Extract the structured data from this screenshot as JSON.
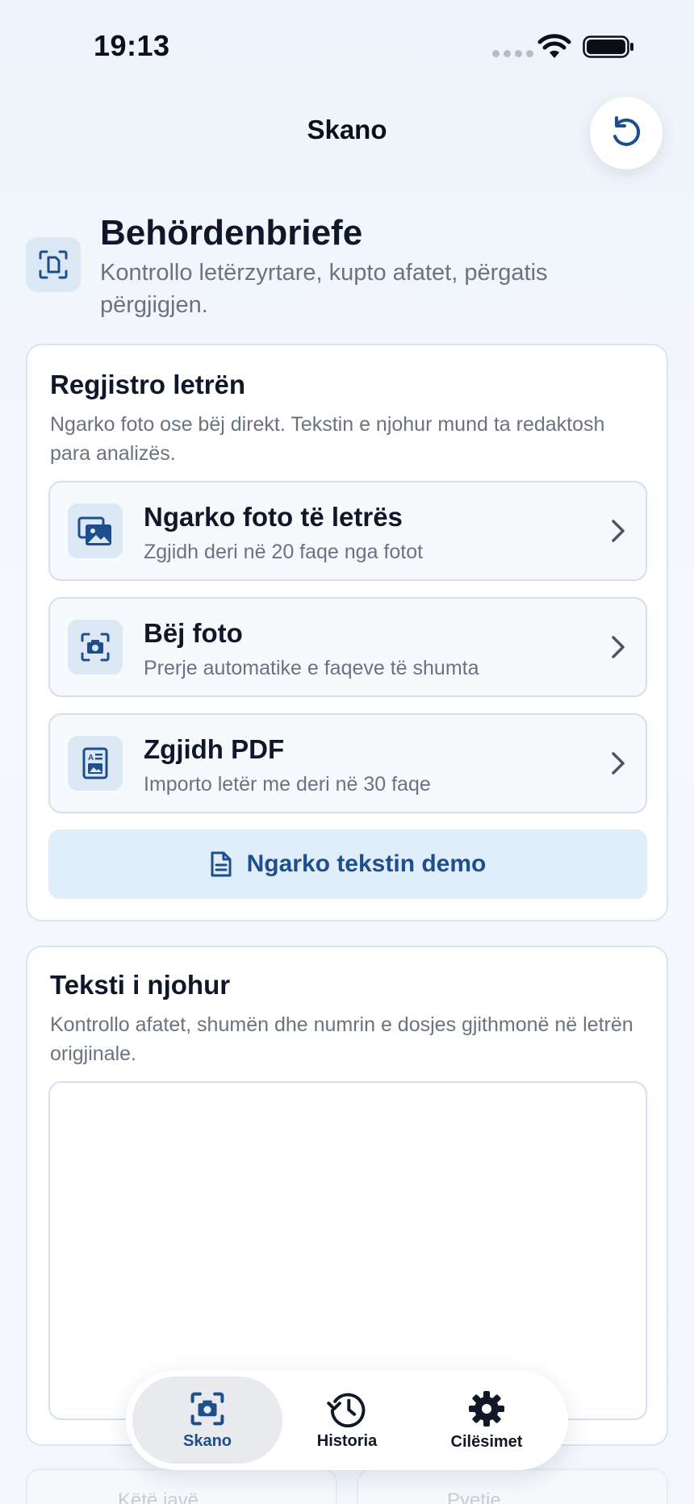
{
  "status_bar": {
    "time": "19:13"
  },
  "nav": {
    "title": "Skano",
    "reset_icon": "rotate-ccw-icon"
  },
  "header": {
    "title": "Behördenbriefe",
    "subtitle": "Kontrollo letërzyrtare, kupto afatet, përgatis përgjigjen.",
    "icon": "document-scan-icon"
  },
  "upload_card": {
    "title": "Regjistro letrën",
    "description": "Ngarko foto ose bëj direkt. Tekstin e njohur mund ta redaktosh para analizës.",
    "options": [
      {
        "title": "Ngarko foto të letrës",
        "subtitle": "Zgjidh deri në 20 faqe nga fotot",
        "icon": "photo-stack-icon"
      },
      {
        "title": "Bëj foto",
        "subtitle": "Prerje automatike e faqeve të shumta",
        "icon": "camera-scan-icon"
      },
      {
        "title": "Zgjidh PDF",
        "subtitle": "Importo letër me deri në 30 faqe",
        "icon": "pdf-document-icon"
      }
    ],
    "demo_button": "Ngarko tekstin demo"
  },
  "text_card": {
    "title": "Teksti i njohur",
    "description": "Kontrollo afatet, shumën dhe numrin e dosjes gjithmonë në letrën origjinale.",
    "text_value": ""
  },
  "faded_cards": [
    "Këtë javë",
    "Pyetje"
  ],
  "tab_bar": {
    "active": "Skano",
    "tabs": [
      {
        "label": "Skano",
        "icon": "camera-scan-icon"
      },
      {
        "label": "Historia",
        "icon": "history-clock-icon"
      },
      {
        "label": "Cilësimet",
        "icon": "gear-icon"
      }
    ]
  },
  "colors": {
    "accent": "#1e4e8c",
    "icon_bg": "#dde8f5",
    "demo_bg": "#e0eefb",
    "border": "#dbe4ef"
  }
}
